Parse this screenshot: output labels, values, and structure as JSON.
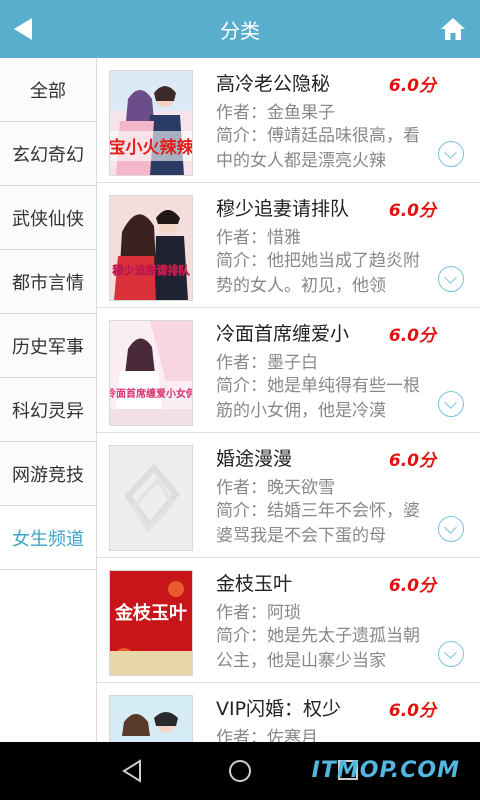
{
  "header": {
    "title": "分类"
  },
  "sidebar": {
    "items": [
      {
        "label": "全部"
      },
      {
        "label": "玄幻奇幻"
      },
      {
        "label": "武侠仙侠"
      },
      {
        "label": "都市言情"
      },
      {
        "label": "历史军事"
      },
      {
        "label": "科幻灵异"
      },
      {
        "label": "网游竞技"
      },
      {
        "label": "女生频道"
      }
    ],
    "active": "女生频道"
  },
  "books": [
    {
      "title": "高冷老公隐秘",
      "score": "6.0分",
      "author": "作者：金鱼果子",
      "intro": "简介：傅靖廷品味很高，看中的女人都是漂亮火辣",
      "cover_text": "宝小火辣辣"
    },
    {
      "title": "穆少追妻请排队",
      "score": "6.0分",
      "author": "作者：惜雅",
      "intro": "简介：他把她当成了趋炎附势的女人。初见，他领",
      "cover_text": "穆少追妻请排队"
    },
    {
      "title": "冷面首席缠爱小",
      "score": "6.0分",
      "author": "作者：墨子白",
      "intro": "简介：她是单纯得有些一根筋的小女佣，他是冷漠",
      "cover_text": "冷面首席缠爱小女佣"
    },
    {
      "title": "婚途漫漫",
      "score": "6.0分",
      "author": "作者：晚天欲雪",
      "intro": "简介：结婚三年不会怀，婆婆骂我是不会下蛋的母",
      "cover_text": ""
    },
    {
      "title": "金枝玉叶",
      "score": "6.0分",
      "author": "作者：阿琐",
      "intro": "简介：她是先太子遗孤当朝公主，他是山寨少当家",
      "cover_text": "金枝玉叶"
    },
    {
      "title": "VIP闪婚：权少",
      "score": "6.0分",
      "author": "作者：佐寒月",
      "intro": "",
      "cover_text": ""
    }
  ],
  "watermark": "ITMOP.COM",
  "colors": {
    "header": "#5aaecd",
    "active": "#3ea3c8",
    "score": "#e0120e"
  }
}
